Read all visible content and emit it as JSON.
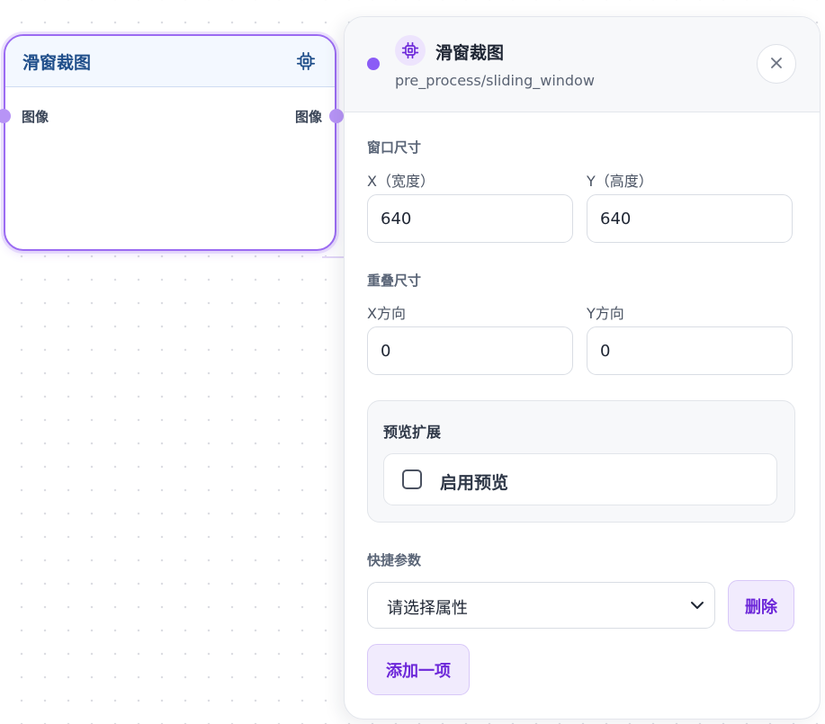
{
  "node": {
    "title": "滑窗裁图",
    "icon": "cpu-chip-icon",
    "input_port": "图像",
    "output_port": "图像"
  },
  "panel": {
    "title": "滑窗裁图",
    "subtitle": "pre_process/sliding_window",
    "icon": "cpu-chip-icon",
    "close_icon": "close-icon",
    "accent_color": "#8b5cf6"
  },
  "window_size": {
    "section_title": "窗口尺寸",
    "x_label": "X（宽度）",
    "x_value": "640",
    "y_label": "Y（高度）",
    "y_value": "640"
  },
  "overlap": {
    "section_title": "重叠尺寸",
    "x_label": "X方向",
    "x_value": "0",
    "y_label": "Y方向",
    "y_value": "0"
  },
  "preview": {
    "section_title": "预览扩展",
    "checkbox_label": "启用预览",
    "checked": false
  },
  "quick_params": {
    "section_title": "快捷参数",
    "select_placeholder": "请选择属性",
    "delete_label": "删除",
    "add_label": "添加一项"
  }
}
